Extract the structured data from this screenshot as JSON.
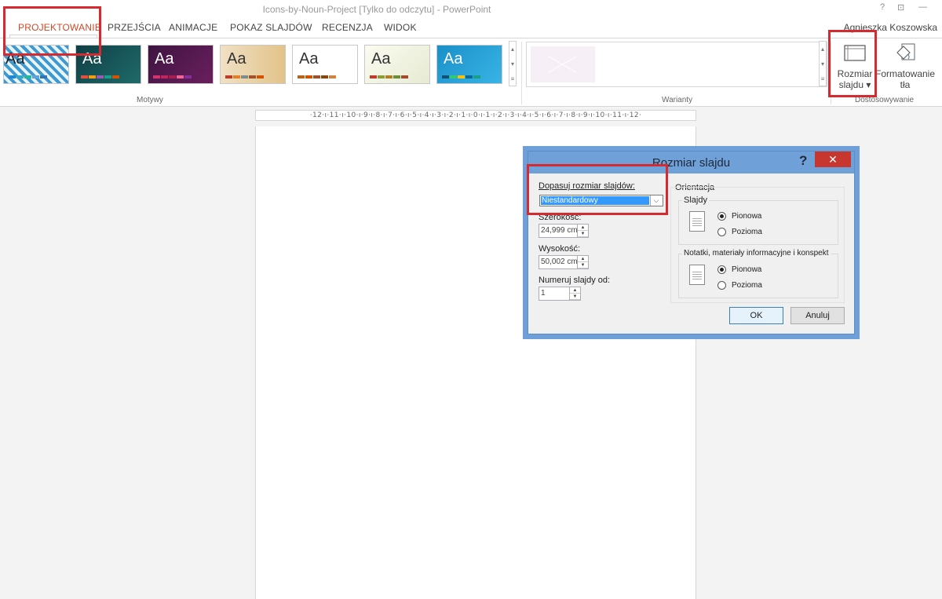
{
  "window": {
    "title": "Icons-by-Noun-Project [Tylko do odczytu] - PowerPoint",
    "help": "?",
    "restore": "⊡",
    "minimize": "—"
  },
  "tabs": [
    "PROJEKTOWANIE",
    "PRZEJŚCIA",
    "ANIMACJE",
    "POKAZ SLAJDÓW",
    "RECENZJA",
    "WIDOK"
  ],
  "active_tab": "PROJEKTOWANIE",
  "user": "Agnieszka Koszowska",
  "ribbon": {
    "themes_label": "Motywy",
    "theme_thumb_text": "Aa",
    "variants_label": "Warianty",
    "customize_label": "Dostosowywanie",
    "slide_size_line1": "Rozmiar",
    "slide_size_line2": "slajdu ▾",
    "format_bg_line1": "Formatowanie",
    "format_bg_line2": "tła"
  },
  "ruler_text": "·12·ı·11·ı·10·ı·9·ı·8·ı·7·ı·6·ı·5·ı·4·ı·3·ı·2·ı·1·ı·0·ı·1·ı·2·ı·3·ı·4·ı·5·ı·6·ı·7·ı·8·ı·9·ı·10·ı·11·ı·12·",
  "dialog": {
    "title": "Rozmiar slajdu",
    "help": "?",
    "close": "✕",
    "fit_label": "Dopasuj rozmiar slajdów:",
    "fit_value": "Niestandardowy",
    "width_label": "Szerokość:",
    "width_value": "24,999 cm",
    "height_label": "Wysokość:",
    "height_value": "50,002 cm",
    "number_label": "Numeruj slajdy od:",
    "number_value": "1",
    "orientation_label": "Orientacja",
    "slides_label": "Slajdy",
    "portrait": "Pionowa",
    "landscape": "Pozioma",
    "notes_label": "Notatki, materiały informacyjne i konspekt",
    "notes_portrait": "Pionowa",
    "notes_landscape": "Pozioma",
    "ok": "OK",
    "cancel": "Anuluj"
  },
  "colors": {
    "accent": "#d24726",
    "highlight": "#d42a30",
    "dialog_frame": "#6fa0d8",
    "close_button": "#c7372f",
    "selection": "#3399ff"
  }
}
